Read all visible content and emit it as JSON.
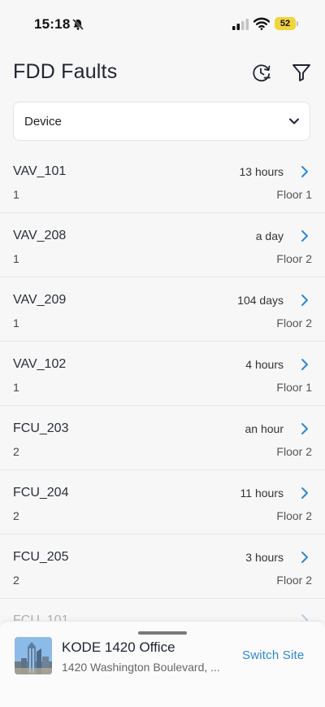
{
  "status_bar": {
    "time": "15:18",
    "battery": "52"
  },
  "header": {
    "title": "FDD Faults"
  },
  "filter": {
    "label": "Device"
  },
  "faults": [
    {
      "name": "VAV_101",
      "count": "1",
      "time": "13 hours",
      "floor": "Floor 1"
    },
    {
      "name": "VAV_208",
      "count": "1",
      "time": "a day",
      "floor": "Floor 2"
    },
    {
      "name": "VAV_209",
      "count": "1",
      "time": "104 days",
      "floor": "Floor 2"
    },
    {
      "name": "VAV_102",
      "count": "1",
      "time": "4 hours",
      "floor": "Floor 1"
    },
    {
      "name": "FCU_203",
      "count": "2",
      "time": "an hour",
      "floor": "Floor 2"
    },
    {
      "name": "FCU_204",
      "count": "2",
      "time": "11 hours",
      "floor": "Floor 2"
    },
    {
      "name": "FCU_205",
      "count": "2",
      "time": "3 hours",
      "floor": "Floor 2"
    }
  ],
  "partial_row": {
    "name": "FCU_101"
  },
  "site": {
    "name": "KODE 1420 Office",
    "address": "1420 Washington Boulevard, ...",
    "switch_label": "Switch Site"
  },
  "colors": {
    "accent": "#2f86d8",
    "battery": "#f2d43b",
    "title": "#1e2433"
  },
  "icons": {
    "history": "history-icon",
    "filter": "filter-icon",
    "chevron_down": "chevron-down-icon",
    "chevron_right": "chevron-right-icon",
    "bell_slash": "bell-slash-icon"
  }
}
